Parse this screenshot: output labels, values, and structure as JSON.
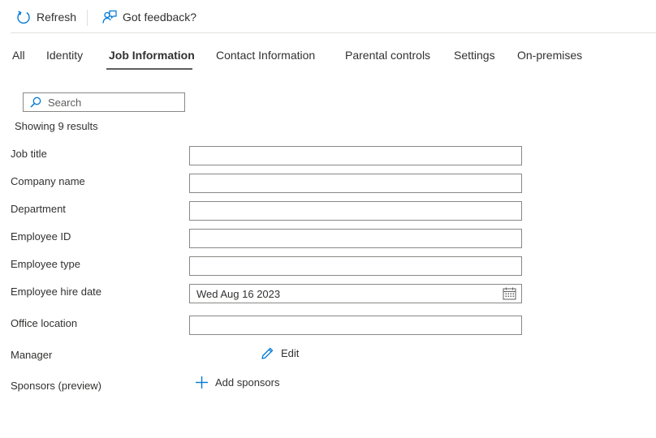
{
  "toolbar": {
    "refresh_label": "Refresh",
    "feedback_label": "Got feedback?"
  },
  "tabs": [
    {
      "label": "All"
    },
    {
      "label": "Identity"
    },
    {
      "label": "Job Information",
      "active": true
    },
    {
      "label": "Contact Information"
    },
    {
      "label": "Parental controls"
    },
    {
      "label": "Settings"
    },
    {
      "label": "On-premises"
    }
  ],
  "search": {
    "placeholder": "Search",
    "value": ""
  },
  "results_text": "Showing 9 results",
  "fields": {
    "job_title": {
      "label": "Job title",
      "value": ""
    },
    "company_name": {
      "label": "Company name",
      "value": ""
    },
    "department": {
      "label": "Department",
      "value": ""
    },
    "employee_id": {
      "label": "Employee ID",
      "value": ""
    },
    "employee_type": {
      "label": "Employee type",
      "value": ""
    },
    "employee_hire_date": {
      "label": "Employee hire date",
      "value": "Wed Aug 16 2023"
    },
    "office_location": {
      "label": "Office location",
      "value": ""
    },
    "manager": {
      "label": "Manager",
      "action_label": "Edit"
    },
    "sponsors": {
      "label": "Sponsors (preview)",
      "action_label": "Add sponsors"
    }
  },
  "icons": {
    "refresh": "refresh-icon",
    "feedback": "feedback-icon",
    "search": "search-icon",
    "calendar": "calendar-icon",
    "edit": "pencil-icon",
    "add": "plus-icon"
  },
  "colors": {
    "accent": "#0078d4",
    "text": "#323130",
    "border": "#8a8886",
    "divider": "#e1dfdd"
  }
}
